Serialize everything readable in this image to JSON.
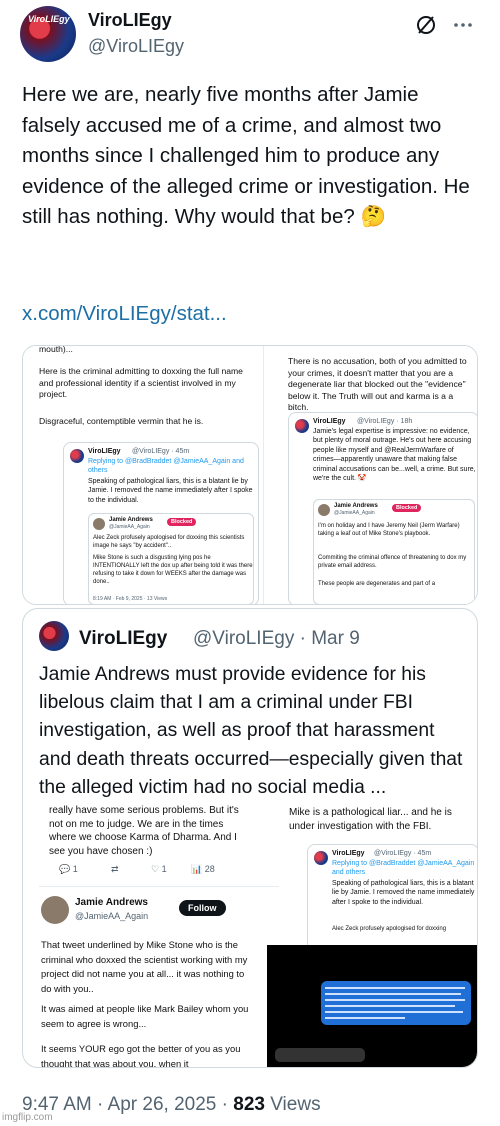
{
  "author": {
    "name": "ViroLIEgy",
    "handle": "@ViroLIEgy",
    "avatar_text": "ViroLIEgy"
  },
  "header_icons": {
    "left": "grok-slash-icon",
    "right": "more-icon"
  },
  "tweet": {
    "text": "Here we are, nearly five months after Jamie falsely accused me of a crime, and almost two months since I challenged him to produce any evidence of the alleged crime or investigation. He still has nothing. Why would that be? 🤔",
    "link": "x.com/ViroLIEgy/stat..."
  },
  "images": {
    "left": {
      "top_text": "mouth)...",
      "p1": "Here is the criminal admitting to doxxing the full name and professional identity if a scientist involved in my project.",
      "p2": "Disgraceful, contemptible vermin that he is.",
      "card": {
        "name": "ViroLIEgy",
        "meta": "@ViroLIEgy · 45m",
        "reply": "Replying to @BradBraddet @JamieAA_Again and others",
        "text": "Speaking of pathological liars, this is a blatant lie by Jamie. I removed the name immediately after I spoke to the individual.",
        "inner_name": "Jamie Andrews",
        "inner_handle": "@JamieAA_Again",
        "blocked": "Blocked",
        "inner_p1": "Alec Zeck profusely apologised for doxxing this scientists image he says \"by accident\"..",
        "inner_p2": "Mike Stone is such a disgusting lying pos he INTENTIONALLY left the dox up after being told it was there refusing to take it down for WEEKS after the damage was done..",
        "inner_ts": "8:19 AM · Feb 9, 2025 · 13 Views"
      }
    },
    "right": {
      "p1": "There is no accusation, both of you admitted to your crimes, it doesn't matter that you are a degenerate liar that blocked out the \"evidence\" below it. The Truth will out and karma is a a bitch.",
      "card": {
        "name": "ViroLIEgy",
        "meta": "@ViroLIEgy · 18h",
        "text": "Jamie's legal expertise is impressive: no evidence, but plenty of moral outrage. He's out here accusing people like myself and @RealJermWarfare of crimes—apparently unaware that making false criminal accusations can be...well, a crime. But sure, we're the cult. 🤡",
        "inner_name": "Jamie Andrews",
        "inner_handle": "@JamieAA_Again",
        "blocked": "Blocked",
        "inner_p1": "I'm on holiday and I have Jeremy Neil (Jerm Warfare) taking a leaf out of Mike Stone's playbook.",
        "inner_p2": "Commiting the criminal offence of threatening to dox my private email address.",
        "inner_p3": "These people are degenerates and part of a"
      }
    }
  },
  "quote": {
    "name": "ViroLIEgy",
    "handle": "@ViroLIEgy · Mar 9",
    "text": "Jamie Andrews must provide evidence for his libelous claim that I am a criminal under FBI investigation, as well as proof that harassment and death threats occurred—especially given that the alleged victim had no social media ...",
    "left_img": {
      "top": "really have some serious problems. But it's not on me to judge. We are in the times where we choose Karma of Dharma. And I see you have chosen :)",
      "act_reply": "1",
      "act_like": "1",
      "act_views": "28",
      "name": "Jamie Andrews",
      "handle": "@JamieAA_Again",
      "follow": "Follow",
      "p1": "That tweet underlined by Mike Stone who is the criminal who doxxed the scientist working with my project did not name you at all... it was nothing to do with you..",
      "p2": "It was aimed at people like Mark Bailey whom you seem to agree is wrong...",
      "p3": "It seems YOUR ego got the better of you as you thought that was about you, when it"
    },
    "right_img": {
      "top": "Mike is a pathological liar... and he is under investigation with the FBI.",
      "card_name": "ViroLIEgy",
      "card_meta": "@ViroLIEgy · 45m",
      "card_reply": "Replying to @BradBraddet @JamieAA_Again and others",
      "card_text": "Speaking of pathological liars, this is a blatant lie by Jamie. I removed the name immediately after I spoke to the individual.",
      "card_inner": "Alec Zeck profusely apologised for doxxing"
    }
  },
  "footer": {
    "time": "9:47 AM · Apr 26, 2025 · ",
    "views_count": "823",
    "views_label": " Views"
  },
  "watermark": "imgflip.com",
  "colors": {
    "link": "#1d6fa5",
    "muted": "#536471",
    "blocked": "#e0245e",
    "text": "#0f1419"
  }
}
